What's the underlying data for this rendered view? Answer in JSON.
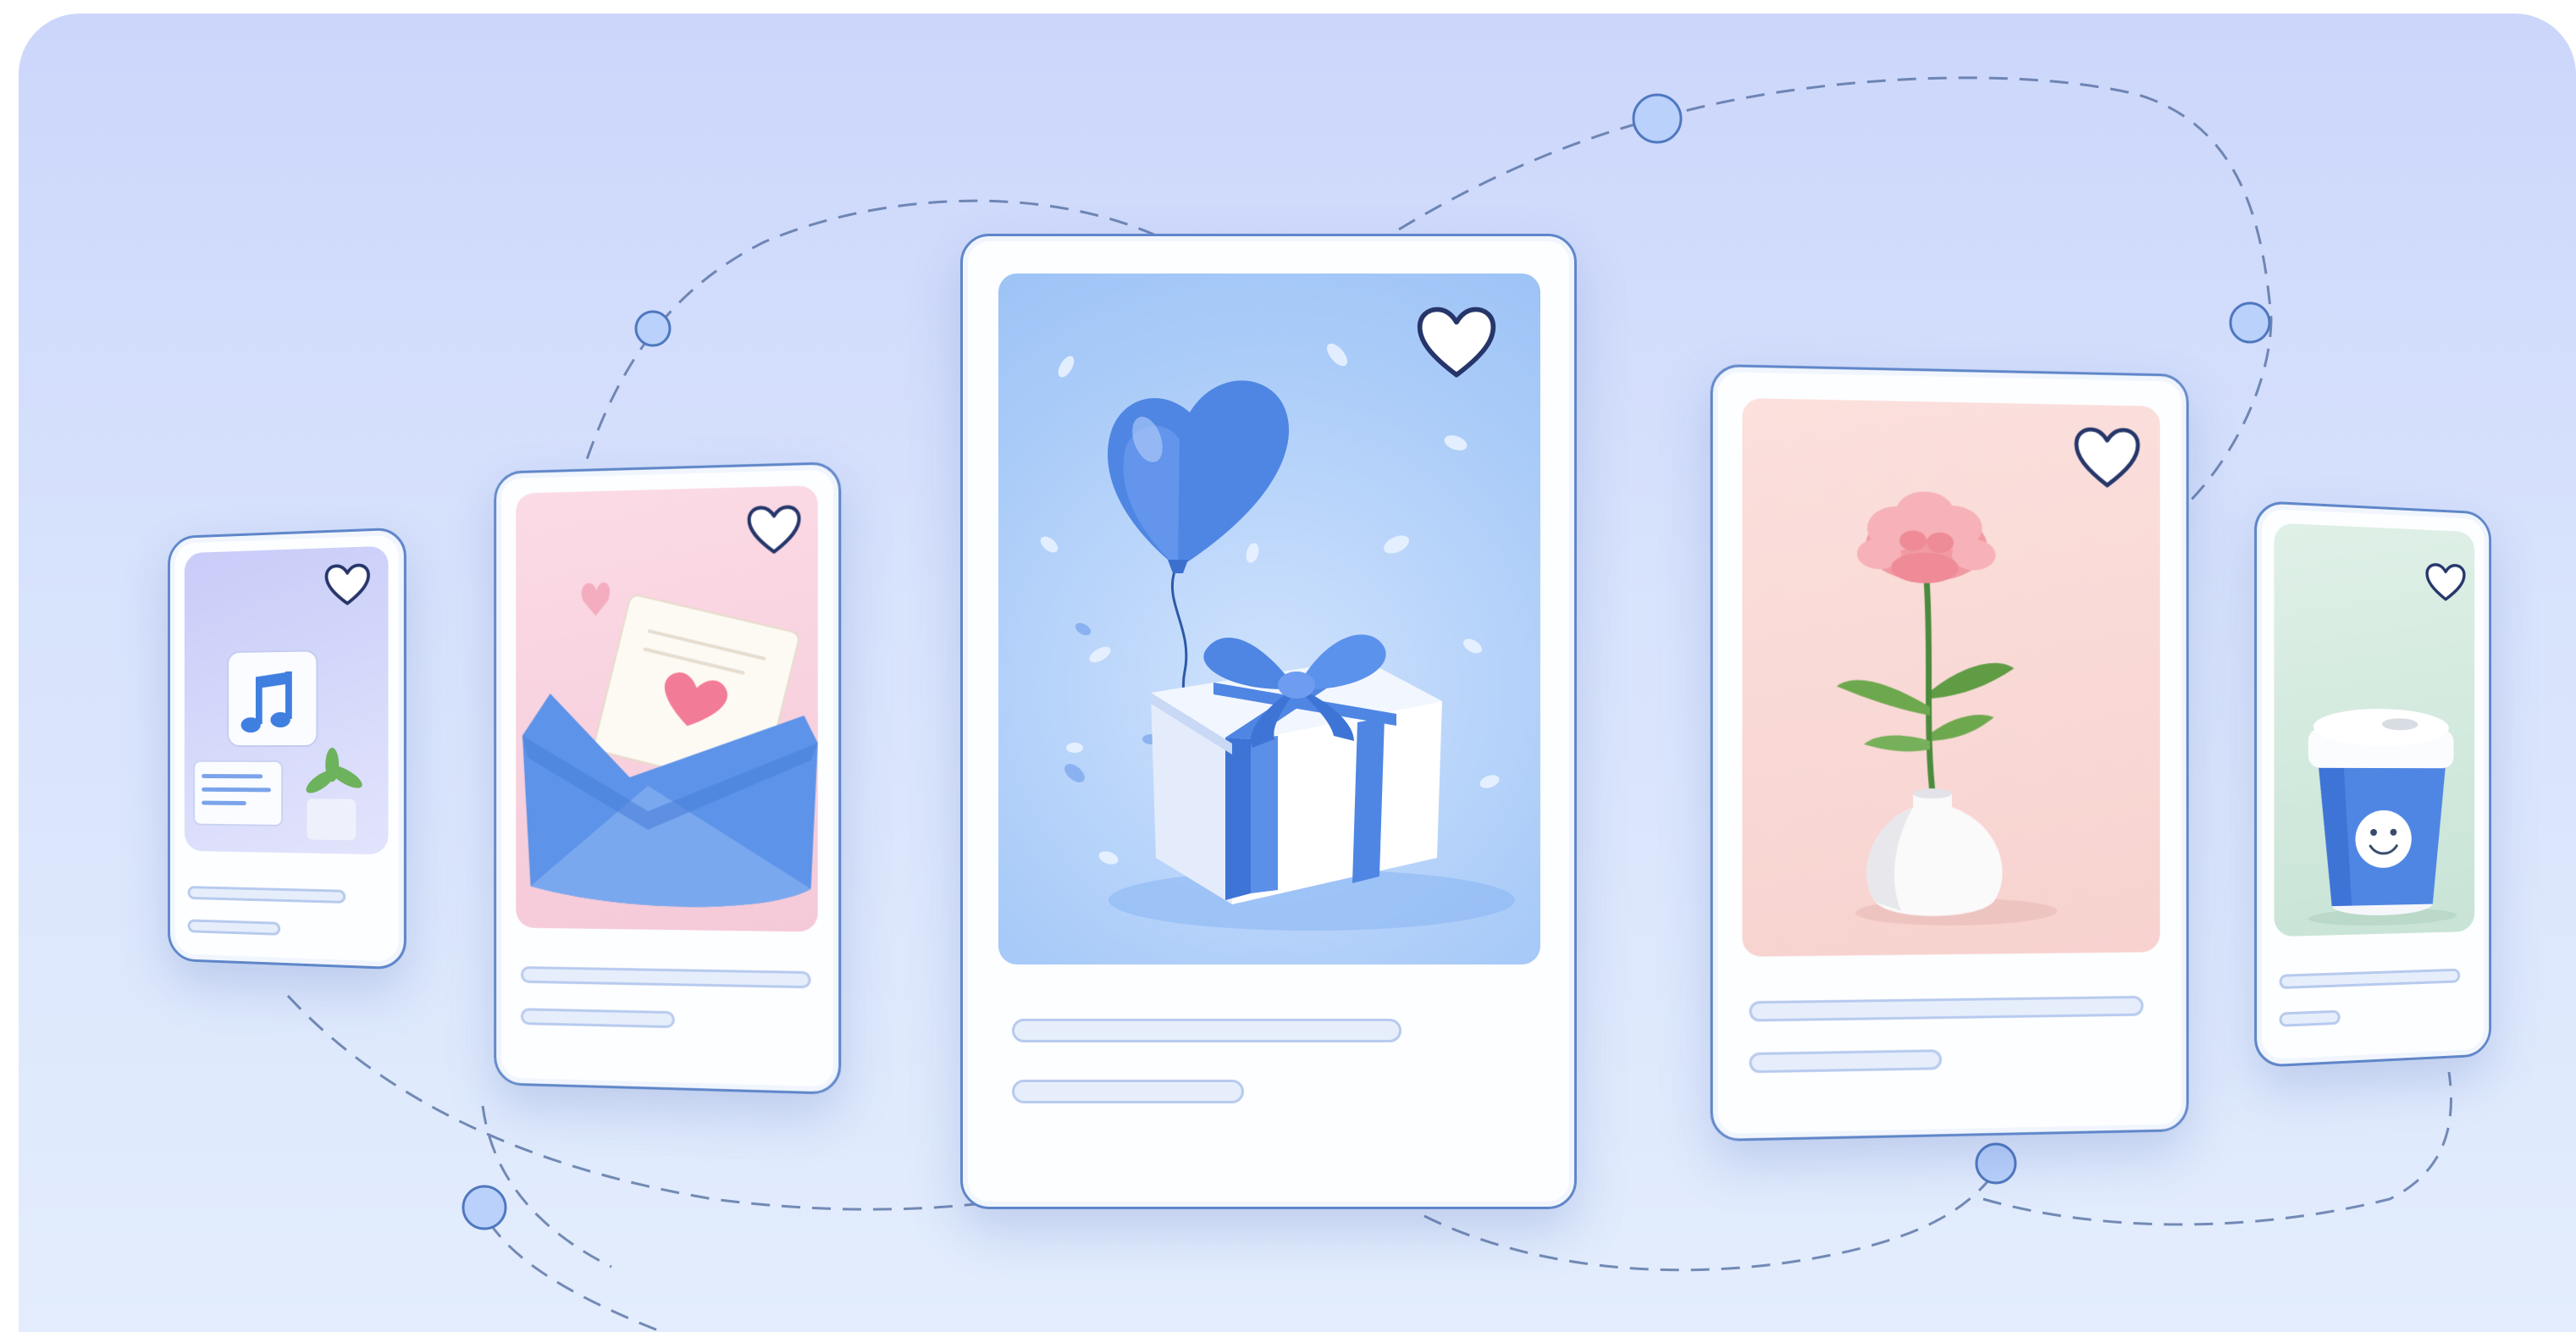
{
  "colors": {
    "background_top": "#ccd6fb",
    "background_bottom": "#e3edfd",
    "card_border": "#5f86c9",
    "heart_outline": "#26366a",
    "accent_blue": "#4f86e3",
    "node_fill": "#b9d1fb",
    "placeholder_line": "#b7caee"
  },
  "cards": [
    {
      "name": "music-card",
      "illustration": "music-note-icon",
      "tint": "#d2d4fb",
      "favorited": false
    },
    {
      "name": "love-letter-card",
      "illustration": "envelope-icon",
      "tint": "#f8d6e2",
      "favorited": false
    },
    {
      "name": "gift-card",
      "illustration": "gift-box-icon",
      "tint": "#a9cbf8",
      "favorited": false
    },
    {
      "name": "flower-card",
      "illustration": "carnation-vase-icon",
      "tint": "#fad8d6",
      "favorited": false
    },
    {
      "name": "coffee-card",
      "illustration": "coffee-cup-icon",
      "tint": "#d4ecdf",
      "favorited": false
    }
  ],
  "icons": [
    "heart-icon",
    "music-note-icon",
    "envelope-icon",
    "gift-box-icon",
    "carnation-vase-icon",
    "coffee-cup-icon",
    "connector-node-icon"
  ]
}
